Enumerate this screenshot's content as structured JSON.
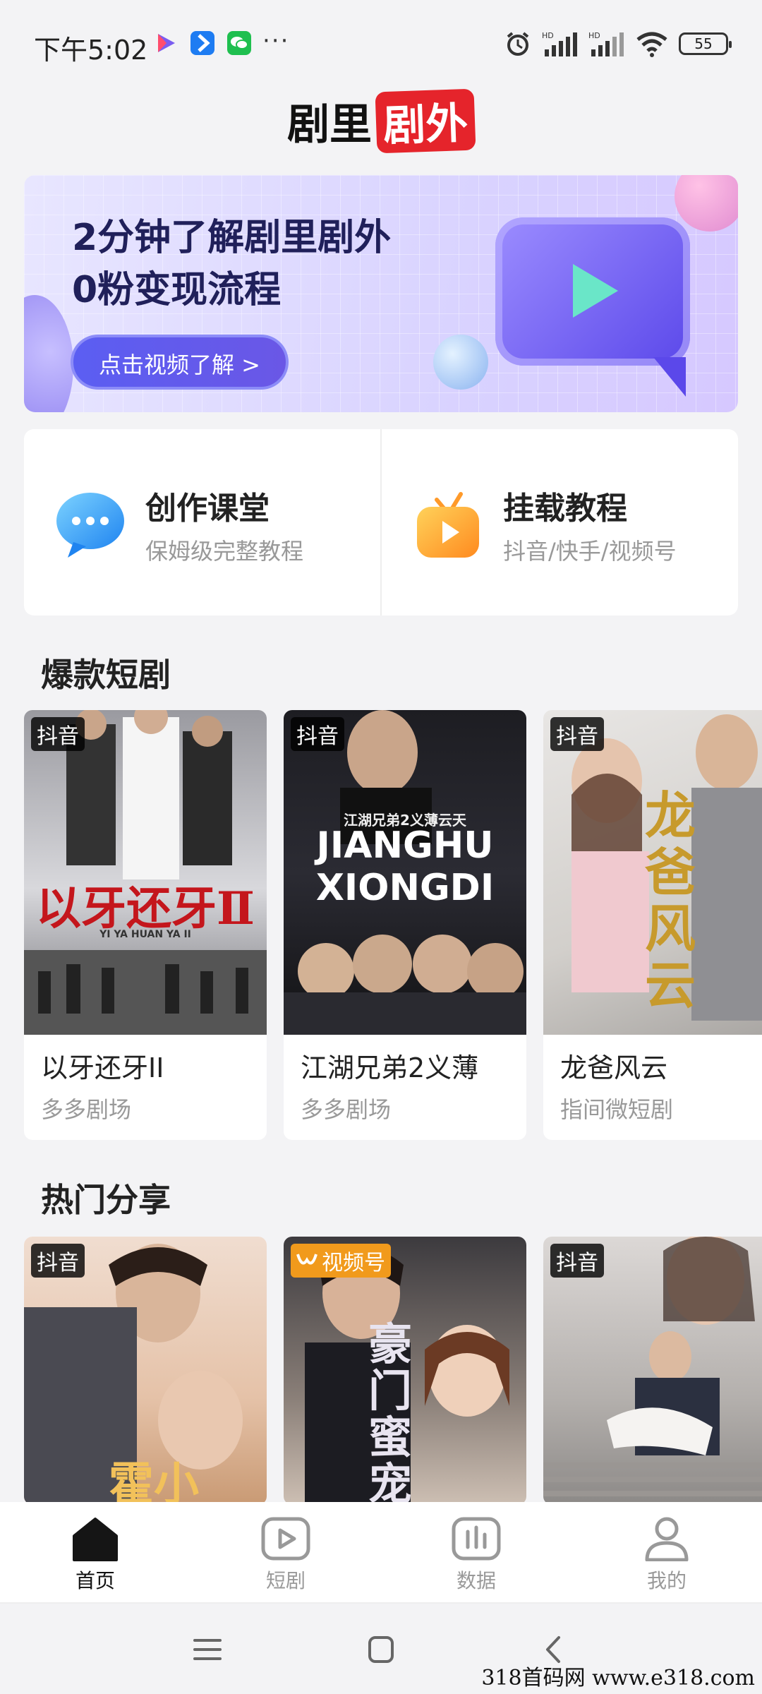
{
  "status_bar": {
    "time": "下午5:02",
    "battery": "55",
    "signal_label_1": "HD",
    "signal_label_2": "HD",
    "more": "···"
  },
  "logo": {
    "part1": "剧里",
    "part2": "剧外"
  },
  "banner": {
    "line1": "2分钟了解剧里剧外",
    "line2": "0粉变现流程",
    "button": "点击视频了解 >"
  },
  "features": [
    {
      "title": "创作课堂",
      "subtitle": "保姆级完整教程"
    },
    {
      "title": "挂载教程",
      "subtitle": "抖音/快手/视频号"
    }
  ],
  "hot_dramas": {
    "title": "爆款短剧",
    "items": [
      {
        "tag": "抖音",
        "title": "以牙还牙II",
        "source": "多多剧场",
        "poster_text": "以牙还牙Ⅱ",
        "poster_sub": "YI YA HUAN YA II"
      },
      {
        "tag": "抖音",
        "title": "江湖兄弟2义薄",
        "source": "多多剧场",
        "poster_text": "JIANGHU XIONGDI",
        "poster_sub": "江湖兄弟2义薄云天"
      },
      {
        "tag": "抖音",
        "title": "龙爸风云",
        "source": "指间微短剧",
        "poster_text": "龙爸风云"
      }
    ]
  },
  "hot_shares": {
    "title": "热门分享",
    "items": [
      {
        "tag": "抖音",
        "poster_text": "霍小"
      },
      {
        "tag": "视频号",
        "poster_text": "豪门蜜宠"
      },
      {
        "tag": "抖音"
      }
    ]
  },
  "bottom_nav": [
    {
      "label": "首页",
      "icon": "home-icon",
      "active": true
    },
    {
      "label": "短剧",
      "icon": "play-icon",
      "active": false
    },
    {
      "label": "数据",
      "icon": "chart-icon",
      "active": false
    },
    {
      "label": "我的",
      "icon": "user-icon",
      "active": false
    }
  ],
  "watermark": "318首码网  www.e318.com"
}
